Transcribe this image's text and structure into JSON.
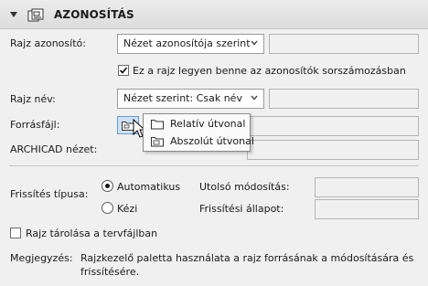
{
  "header": {
    "title": "AZONOSÍTÁS",
    "icon": "drawing-id-icon"
  },
  "drawing_id": {
    "label": "Rajz azonosító:",
    "value": "Nézet azonosítója szerint"
  },
  "include_checkbox": {
    "label": "Ez a rajz legyen benne az azonosítók sorszámozásban",
    "checked": true
  },
  "drawing_name": {
    "label": "Rajz név:",
    "value": "Nézet szerint: Csak név"
  },
  "source_file": {
    "label": "Forrásfájl:"
  },
  "path_menu": {
    "items": [
      {
        "label": "Relatív útvonal",
        "icon": "folder-icon"
      },
      {
        "label": "Abszolút útvonal",
        "icon": "folder-icon"
      }
    ]
  },
  "archicad_view": {
    "label": "ARCHICAD nézet:"
  },
  "update_type": {
    "label": "Frissítés típusa:",
    "options": [
      {
        "label": "Automatikus",
        "selected": true
      },
      {
        "label": "Kézi",
        "selected": false
      }
    ]
  },
  "last_modified": {
    "label": "Utolsó módosítás:"
  },
  "update_status": {
    "label": "Frissítési állapot:"
  },
  "store_checkbox": {
    "label": "Rajz tárolása a tervfájlban",
    "checked": false
  },
  "note": {
    "label": "Megjegyzés:",
    "text_line1": "Rajzkezelő paletta használata a rajz forrásának a módosítására és",
    "text_line2": "frissítésére."
  }
}
